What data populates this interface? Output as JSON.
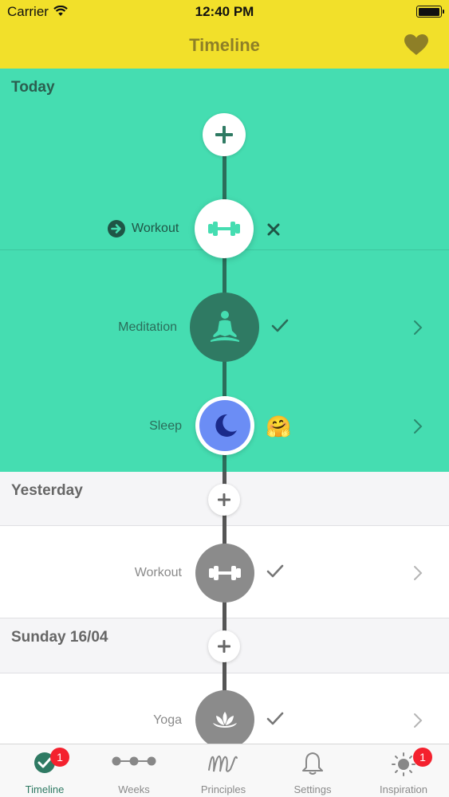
{
  "status_bar": {
    "carrier": "Carrier",
    "time": "12:40 PM"
  },
  "nav": {
    "title": "Timeline",
    "favorite_icon": "heart-icon"
  },
  "colors": {
    "nav_yellow": "#f2e02a",
    "today_green": "#45ddb1",
    "dark_green": "#2f7a63",
    "gray_circle": "#8b8b8b",
    "sleep_blue": "#6b8df5",
    "badge_red": "#f4212e"
  },
  "today": {
    "title": "Today",
    "workout": {
      "label": "Workout"
    },
    "meditation": {
      "label": "Meditation"
    },
    "sleep": {
      "label": "Sleep",
      "emoji": "🤗"
    }
  },
  "yesterday": {
    "title": "Yesterday",
    "workout": {
      "label": "Workout"
    }
  },
  "sunday": {
    "title": "Sunday 16/04",
    "yoga": {
      "label": "Yoga"
    }
  },
  "tabs": [
    {
      "label": "Timeline",
      "badge": "1"
    },
    {
      "label": "Weeks"
    },
    {
      "label": "Principles"
    },
    {
      "label": "Settings"
    },
    {
      "label": "Inspiration",
      "badge": "1"
    }
  ]
}
